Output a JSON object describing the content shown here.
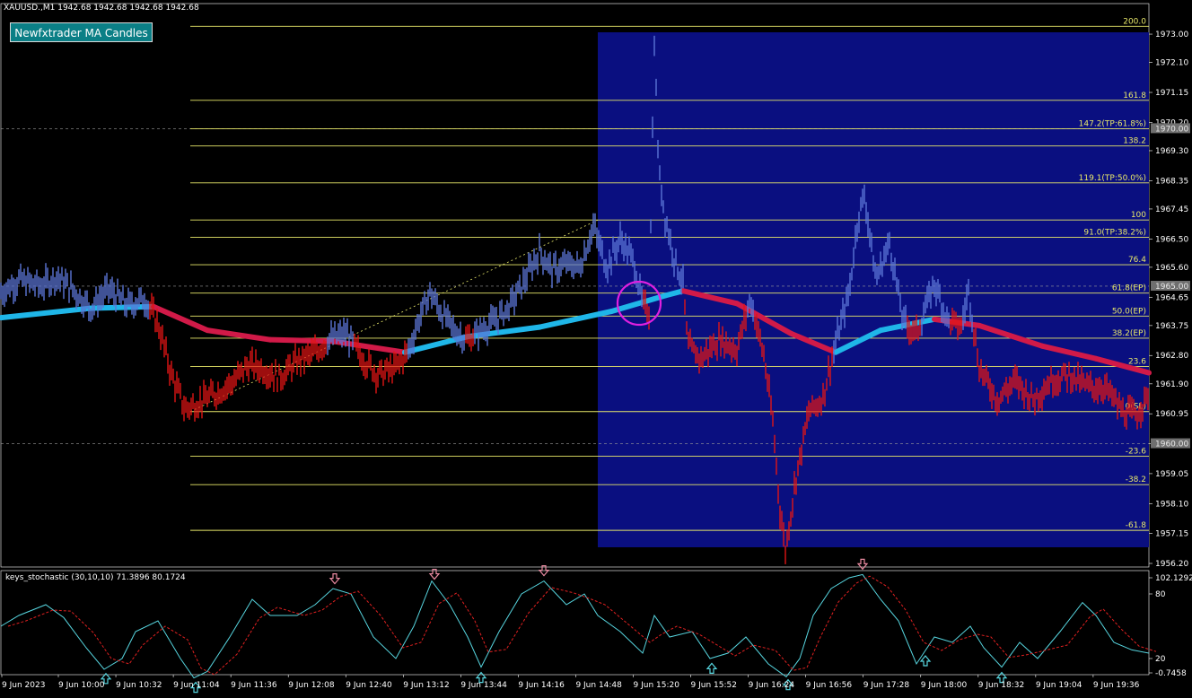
{
  "header": {
    "symbol_line": "XAUUSD.,M1  1942.68 1942.68 1942.68 1942.68",
    "indicator_button": "Newfxtrader MA Candles"
  },
  "subwindow": {
    "title": "keys_stochastic (30,10,10) 71.3896 80.1724"
  },
  "chart_data": {
    "type": "candlestick",
    "symbol": "XAUUSD.",
    "timeframe": "M1",
    "price_axis": {
      "ylim": [
        1956.2,
        1973.4
      ],
      "ticks": [
        "1973.00",
        "1972.10",
        "1971.15",
        "1970.20",
        "1969.30",
        "1968.35",
        "1967.45",
        "1966.50",
        "1965.60",
        "1964.65",
        "1963.75",
        "1962.80",
        "1961.90",
        "1960.95",
        "1960.00",
        "1959.05",
        "1958.10",
        "1957.15",
        "1956.20"
      ],
      "highlighted_levels": [
        "1970.00",
        "1965.00",
        "1960.00"
      ]
    },
    "time_axis": {
      "labels": [
        "9 Jun 2023",
        "9 Jun 10:00",
        "9 Jun 10:32",
        "9 Jun 11:04",
        "9 Jun 11:36",
        "9 Jun 12:08",
        "9 Jun 12:40",
        "9 Jun 13:12",
        "9 Jun 13:44",
        "9 Jun 14:16",
        "9 Jun 14:48",
        "9 Jun 15:20",
        "9 Jun 15:52",
        "9 Jun 16:24",
        "9 Jun 16:56",
        "9 Jun 17:28",
        "9 Jun 18:00",
        "9 Jun 18:32",
        "9 Jun 19:04",
        "9 Jun 19:36"
      ]
    },
    "fibonacci": [
      {
        "label": "200.0",
        "price": 1973.25
      },
      {
        "label": "161.8",
        "price": 1970.9
      },
      {
        "label": "147.2(TP:61.8%)",
        "price": 1970.0
      },
      {
        "label": "138.2",
        "price": 1969.45
      },
      {
        "label": "119.1(TP:50.0%)",
        "price": 1968.28
      },
      {
        "label": "100",
        "price": 1967.1
      },
      {
        "label": "91.0(TP:38.2%)",
        "price": 1966.55
      },
      {
        "label": "76.4",
        "price": 1965.68
      },
      {
        "label": "61.8(EP)",
        "price": 1964.78
      },
      {
        "label": "50.0(EP)",
        "price": 1964.05
      },
      {
        "label": "38.2(EP)",
        "price": 1963.35
      },
      {
        "label": "23.6",
        "price": 1962.45
      },
      {
        "label": "0(SL)",
        "price": 1961.02
      },
      {
        "label": "-23.6",
        "price": 1959.6
      },
      {
        "label": "-38.2",
        "price": 1958.7
      },
      {
        "label": "-61.8",
        "price": 1957.25
      }
    ],
    "price_path": [
      {
        "t": 0,
        "p": 1964.8
      },
      {
        "t": 20,
        "p": 1965.2
      },
      {
        "t": 45,
        "p": 1965.0
      },
      {
        "t": 62,
        "p": 1965.3
      },
      {
        "t": 80,
        "p": 1964.9
      },
      {
        "t": 100,
        "p": 1964.3
      },
      {
        "t": 120,
        "p": 1964.9
      },
      {
        "t": 140,
        "p": 1964.4
      },
      {
        "t": 160,
        "p": 1964.6
      },
      {
        "t": 175,
        "p": 1963.8
      },
      {
        "t": 190,
        "p": 1962.2
      },
      {
        "t": 205,
        "p": 1961.1
      },
      {
        "t": 220,
        "p": 1961.3
      },
      {
        "t": 240,
        "p": 1961.6
      },
      {
        "t": 260,
        "p": 1962.0
      },
      {
        "t": 275,
        "p": 1962.5
      },
      {
        "t": 290,
        "p": 1962.4
      },
      {
        "t": 310,
        "p": 1962.1
      },
      {
        "t": 330,
        "p": 1962.6
      },
      {
        "t": 350,
        "p": 1962.9
      },
      {
        "t": 365,
        "p": 1963.3
      },
      {
        "t": 385,
        "p": 1963.5
      },
      {
        "t": 400,
        "p": 1962.8
      },
      {
        "t": 420,
        "p": 1962.2
      },
      {
        "t": 440,
        "p": 1962.4
      },
      {
        "t": 455,
        "p": 1963.0
      },
      {
        "t": 465,
        "p": 1963.9
      },
      {
        "t": 478,
        "p": 1964.8
      },
      {
        "t": 490,
        "p": 1964.2
      },
      {
        "t": 505,
        "p": 1963.6
      },
      {
        "t": 520,
        "p": 1963.3
      },
      {
        "t": 535,
        "p": 1963.6
      },
      {
        "t": 550,
        "p": 1963.9
      },
      {
        "t": 565,
        "p": 1964.3
      },
      {
        "t": 580,
        "p": 1965.0
      },
      {
        "t": 600,
        "p": 1966.1
      },
      {
        "t": 615,
        "p": 1965.5
      },
      {
        "t": 630,
        "p": 1965.7
      },
      {
        "t": 645,
        "p": 1965.6
      },
      {
        "t": 660,
        "p": 1966.9
      },
      {
        "t": 675,
        "p": 1965.6
      },
      {
        "t": 690,
        "p": 1966.5
      },
      {
        "t": 705,
        "p": 1965.8
      },
      {
        "t": 715,
        "p": 1964.4
      },
      {
        "t": 722,
        "p": 1964.2
      },
      {
        "t": 728,
        "p": 1972.8
      },
      {
        "t": 733,
        "p": 1968.6
      },
      {
        "t": 740,
        "p": 1967.2
      },
      {
        "t": 750,
        "p": 1965.9
      },
      {
        "t": 760,
        "p": 1965.1
      },
      {
        "t": 765,
        "p": 1963.1
      },
      {
        "t": 780,
        "p": 1962.7
      },
      {
        "t": 800,
        "p": 1963.3
      },
      {
        "t": 820,
        "p": 1963.0
      },
      {
        "t": 835,
        "p": 1964.6
      },
      {
        "t": 850,
        "p": 1962.8
      },
      {
        "t": 860,
        "p": 1960.7
      },
      {
        "t": 868,
        "p": 1957.9
      },
      {
        "t": 874,
        "p": 1956.6
      },
      {
        "t": 885,
        "p": 1958.8
      },
      {
        "t": 900,
        "p": 1961.0
      },
      {
        "t": 915,
        "p": 1961.4
      },
      {
        "t": 930,
        "p": 1963.2
      },
      {
        "t": 945,
        "p": 1964.8
      },
      {
        "t": 955,
        "p": 1967.2
      },
      {
        "t": 962,
        "p": 1967.9
      },
      {
        "t": 975,
        "p": 1965.2
      },
      {
        "t": 990,
        "p": 1966.4
      },
      {
        "t": 1005,
        "p": 1963.9
      },
      {
        "t": 1020,
        "p": 1963.5
      },
      {
        "t": 1040,
        "p": 1965.1
      },
      {
        "t": 1055,
        "p": 1963.9
      },
      {
        "t": 1070,
        "p": 1963.7
      },
      {
        "t": 1078,
        "p": 1964.9
      },
      {
        "t": 1090,
        "p": 1962.4
      },
      {
        "t": 1110,
        "p": 1961.4
      },
      {
        "t": 1130,
        "p": 1962.0
      },
      {
        "t": 1150,
        "p": 1961.4
      },
      {
        "t": 1170,
        "p": 1962.0
      },
      {
        "t": 1190,
        "p": 1962.2
      },
      {
        "t": 1210,
        "p": 1961.8
      },
      {
        "t": 1230,
        "p": 1961.8
      },
      {
        "t": 1250,
        "p": 1961.0
      },
      {
        "t": 1265,
        "p": 1960.9
      },
      {
        "t": 1279,
        "p": 1961.6
      }
    ],
    "moving_average": [
      {
        "t": 0,
        "p": 1964.0
      },
      {
        "t": 100,
        "p": 1964.3
      },
      {
        "t": 170,
        "p": 1964.35
      },
      {
        "t": 230,
        "p": 1963.6
      },
      {
        "t": 300,
        "p": 1963.3
      },
      {
        "t": 370,
        "p": 1963.25
      },
      {
        "t": 450,
        "p": 1962.9
      },
      {
        "t": 520,
        "p": 1963.4
      },
      {
        "t": 600,
        "p": 1963.7
      },
      {
        "t": 680,
        "p": 1964.2
      },
      {
        "t": 740,
        "p": 1964.7
      },
      {
        "t": 760,
        "p": 1964.85
      },
      {
        "t": 820,
        "p": 1964.45
      },
      {
        "t": 880,
        "p": 1963.5
      },
      {
        "t": 930,
        "p": 1962.9
      },
      {
        "t": 980,
        "p": 1963.6
      },
      {
        "t": 1040,
        "p": 1963.95
      },
      {
        "t": 1090,
        "p": 1963.75
      },
      {
        "t": 1160,
        "p": 1963.1
      },
      {
        "t": 1220,
        "p": 1962.7
      },
      {
        "t": 1279,
        "p": 1962.25
      }
    ],
    "stochastic": {
      "params": "(30,10,10)",
      "main": 71.3896,
      "signal": 80.1724,
      "scale_labels": [
        "102.1292",
        "80",
        "20",
        "-0.7458"
      ],
      "main_path": [
        {
          "t": 0,
          "v": 50
        },
        {
          "t": 20,
          "v": 60
        },
        {
          "t": 50,
          "v": 70
        },
        {
          "t": 70,
          "v": 58
        },
        {
          "t": 95,
          "v": 30
        },
        {
          "t": 115,
          "v": 10
        },
        {
          "t": 135,
          "v": 20
        },
        {
          "t": 150,
          "v": 45
        },
        {
          "t": 175,
          "v": 55
        },
        {
          "t": 200,
          "v": 20
        },
        {
          "t": 215,
          "v": 2
        },
        {
          "t": 230,
          "v": 8
        },
        {
          "t": 255,
          "v": 40
        },
        {
          "t": 280,
          "v": 75
        },
        {
          "t": 300,
          "v": 60
        },
        {
          "t": 330,
          "v": 60
        },
        {
          "t": 350,
          "v": 70
        },
        {
          "t": 370,
          "v": 85
        },
        {
          "t": 390,
          "v": 80
        },
        {
          "t": 415,
          "v": 40
        },
        {
          "t": 440,
          "v": 20
        },
        {
          "t": 460,
          "v": 50
        },
        {
          "t": 480,
          "v": 92
        },
        {
          "t": 500,
          "v": 70
        },
        {
          "t": 520,
          "v": 40
        },
        {
          "t": 535,
          "v": 12
        },
        {
          "t": 555,
          "v": 45
        },
        {
          "t": 580,
          "v": 80
        },
        {
          "t": 605,
          "v": 92
        },
        {
          "t": 630,
          "v": 70
        },
        {
          "t": 650,
          "v": 80
        },
        {
          "t": 665,
          "v": 60
        },
        {
          "t": 690,
          "v": 45
        },
        {
          "t": 715,
          "v": 25
        },
        {
          "t": 728,
          "v": 60
        },
        {
          "t": 745,
          "v": 40
        },
        {
          "t": 770,
          "v": 45
        },
        {
          "t": 790,
          "v": 20
        },
        {
          "t": 810,
          "v": 25
        },
        {
          "t": 830,
          "v": 40
        },
        {
          "t": 855,
          "v": 15
        },
        {
          "t": 875,
          "v": 3
        },
        {
          "t": 890,
          "v": 20
        },
        {
          "t": 905,
          "v": 60
        },
        {
          "t": 925,
          "v": 85
        },
        {
          "t": 945,
          "v": 95
        },
        {
          "t": 960,
          "v": 98
        },
        {
          "t": 980,
          "v": 75
        },
        {
          "t": 1000,
          "v": 55
        },
        {
          "t": 1020,
          "v": 15
        },
        {
          "t": 1040,
          "v": 40
        },
        {
          "t": 1060,
          "v": 35
        },
        {
          "t": 1080,
          "v": 50
        },
        {
          "t": 1095,
          "v": 30
        },
        {
          "t": 1115,
          "v": 12
        },
        {
          "t": 1135,
          "v": 35
        },
        {
          "t": 1155,
          "v": 20
        },
        {
          "t": 1180,
          "v": 45
        },
        {
          "t": 1205,
          "v": 72
        },
        {
          "t": 1220,
          "v": 60
        },
        {
          "t": 1240,
          "v": 35
        },
        {
          "t": 1260,
          "v": 28
        },
        {
          "t": 1279,
          "v": 25
        }
      ],
      "buy_arrows_t": [
        117,
        217,
        535,
        792,
        877,
        1030,
        1115
      ],
      "sell_arrows_t": [
        372,
        483,
        605,
        960
      ]
    }
  },
  "colors": {
    "background": "#000000",
    "highlight_box": "#0a0f80",
    "bull_candle": "#5b75d6",
    "bear_candle": "#e01515",
    "ma_up": "#1fb6e8",
    "ma_down": "#d11a48",
    "fib_line": "#e8e86a",
    "circle": "#e020e0",
    "stoch_main": "#57d6e0",
    "stoch_signal": "#e02020",
    "grid_text": "#ffffff"
  }
}
